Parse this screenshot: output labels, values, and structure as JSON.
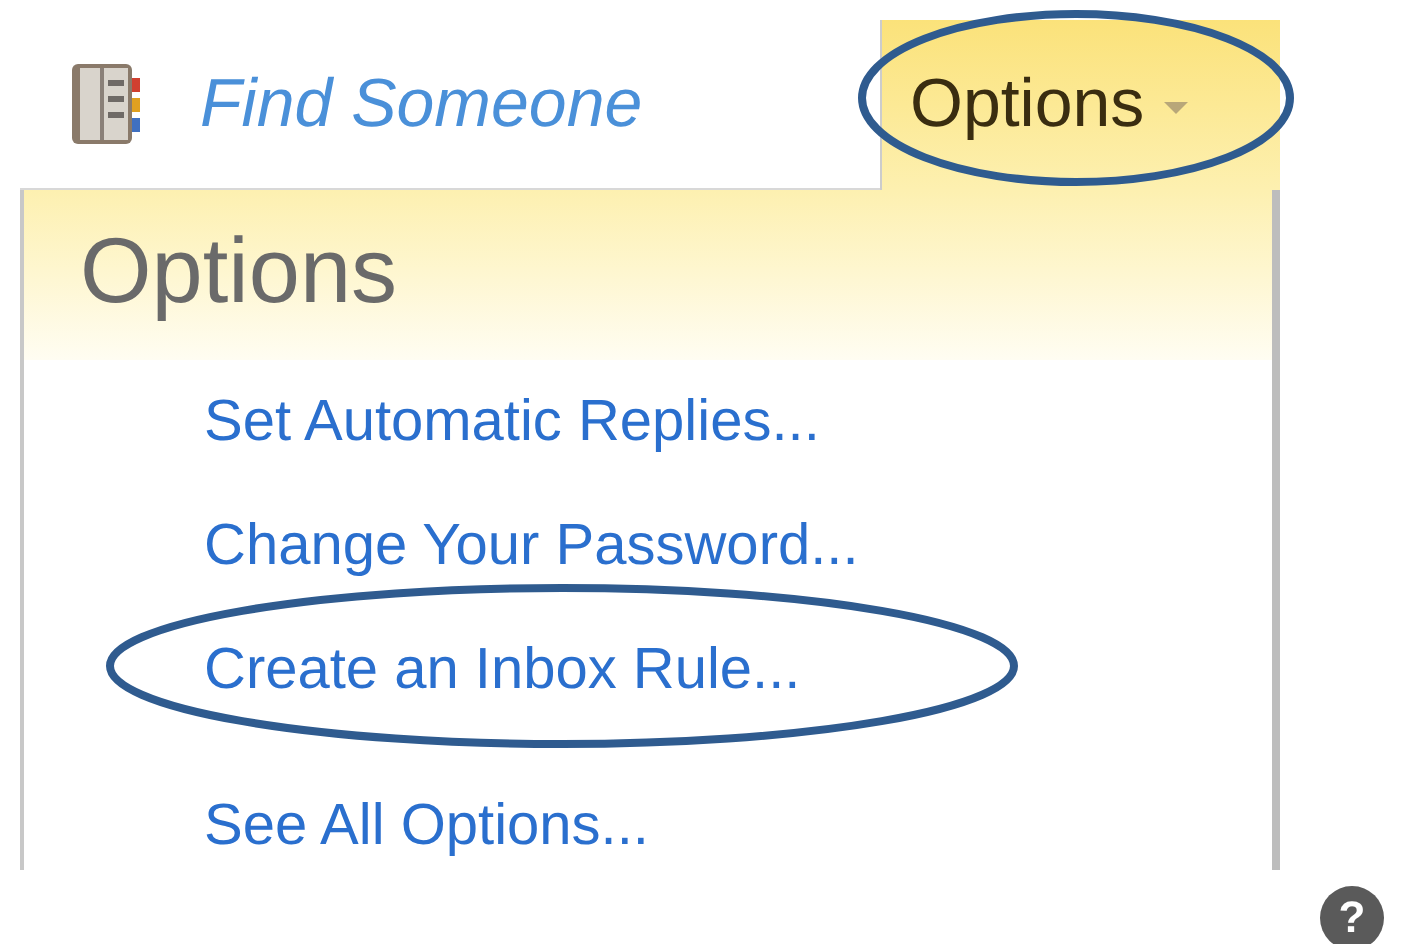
{
  "search_link": {
    "label": "Find Someone"
  },
  "options_button": {
    "label": "Options",
    "circled": true
  },
  "panel": {
    "title": "Options",
    "items": [
      {
        "label": "Set Automatic Replies...",
        "circled": false
      },
      {
        "label": "Change Your Password...",
        "circled": false
      },
      {
        "label": "Create an Inbox Rule...",
        "circled": true
      },
      {
        "label": "See All Options...",
        "circled": false
      }
    ]
  },
  "help_button": {
    "label": "?"
  }
}
